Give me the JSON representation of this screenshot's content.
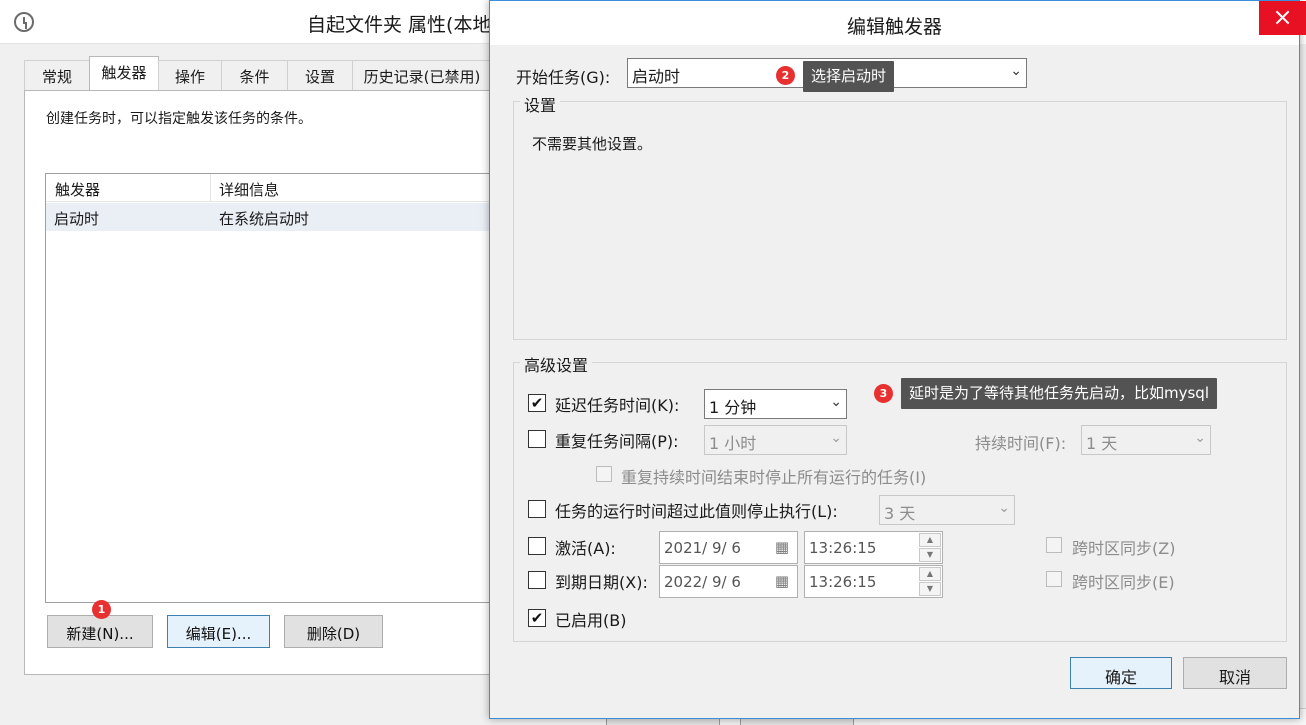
{
  "properties_window": {
    "title": "自起文件夹 属性(本地",
    "tabs": [
      {
        "label": "常规"
      },
      {
        "label": "触发器",
        "active": true
      },
      {
        "label": "操作"
      },
      {
        "label": "条件"
      },
      {
        "label": "设置"
      },
      {
        "label": "历史记录(已禁用)"
      }
    ],
    "description": "创建任务时，可以指定触发该任务的条件。",
    "list": {
      "headers": [
        "触发器",
        "详细信息"
      ],
      "rows": [
        {
          "trigger": "启动时",
          "details": "在系统启动时"
        }
      ]
    },
    "buttons": {
      "new": "新建(N)...",
      "edit": "编辑(E)...",
      "delete": "删除(D)"
    }
  },
  "dialog": {
    "title": "编辑触发器",
    "close_glyph": "×",
    "begin_task_label": "开始任务(G):",
    "begin_task_value": "启动时",
    "settings_group": {
      "title": "设置",
      "message": "不需要其他设置。"
    },
    "advanced_group": {
      "title": "高级设置",
      "delay": {
        "label": "延迟任务时间(K):",
        "checked": true,
        "value": "1 分钟"
      },
      "repeat": {
        "label": "重复任务间隔(P):",
        "checked": false,
        "value": "1 小时",
        "duration_label": "持续时间(F):",
        "duration_value": "1 天"
      },
      "stop_all": {
        "label": "重复持续时间结束时停止所有运行的任务(I)",
        "checked": false
      },
      "stop_if_longer": {
        "label": "任务的运行时间超过此值则停止执行(L):",
        "checked": false,
        "value": "3 天"
      },
      "activate": {
        "label": "激活(A):",
        "checked": false,
        "date": "2021/ 9/ 6",
        "time": "13:26:15",
        "sync_label": "跨时区同步(Z)"
      },
      "expire": {
        "label": "到期日期(X):",
        "checked": false,
        "date": "2022/ 9/ 6",
        "time": "13:26:15",
        "sync_label": "跨时区同步(E)"
      },
      "enabled": {
        "label": "已启用(B)",
        "checked": true
      }
    },
    "ok_label": "确定",
    "cancel_label": "取消"
  },
  "annotations": [
    {
      "number": "1"
    },
    {
      "number": "2",
      "text": "选择启动时"
    },
    {
      "number": "3",
      "text": "延时是为了等待其他任务先启动，比如mysql"
    }
  ],
  "icons": {
    "checked_glyph": "✔",
    "dropdown_glyph": "⌄",
    "calendar_glyph": "▦",
    "spin_up_glyph": "▲",
    "spin_down_glyph": "▼"
  },
  "colors": {
    "accent_border": "#3a8fd8",
    "badge_red": "#e7302f",
    "tooltip_bg": "#535353",
    "close_red": "#e81123"
  }
}
